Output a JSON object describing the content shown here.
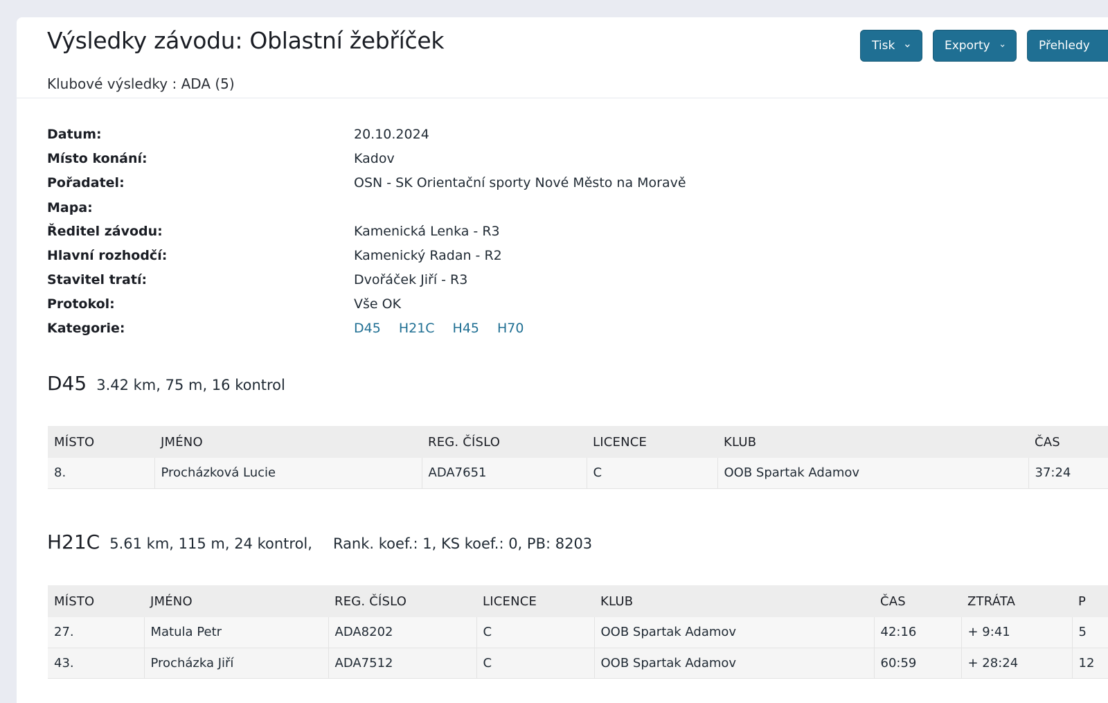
{
  "header": {
    "title": "Výsledky závodu: Oblastní žebříček",
    "subtitle": "Klubové výsledky : ADA (5)",
    "buttons": {
      "tisk": "Tisk",
      "exporty": "Exporty",
      "prehledy": "Přehledy"
    }
  },
  "info": [
    {
      "label": "Datum:",
      "value": "20.10.2024"
    },
    {
      "label": "Místo konání:",
      "value": "Kadov"
    },
    {
      "label": "Pořadatel:",
      "value": "OSN - SK Orientační sporty Nové Město na Moravě"
    },
    {
      "label": "Mapa:",
      "value": ""
    },
    {
      "label": "Ředitel závodu:",
      "value": "Kamenická Lenka - R3"
    },
    {
      "label": "Hlavní rozhodčí:",
      "value": "Kamenický Radan - R2"
    },
    {
      "label": "Stavitel tratí:",
      "value": "Dvořáček Jiří - R3"
    },
    {
      "label": "Protokol:",
      "value": "Vše OK"
    },
    {
      "label": "Kategorie:",
      "value": ""
    }
  ],
  "categories": [
    "D45",
    "H21C",
    "H45",
    "H70"
  ],
  "sections": {
    "d45": {
      "code": "D45",
      "desc": "3.42 km, 75 m, 16 kontrol",
      "columns": [
        "Místo",
        "Jméno",
        "Reg. číslo",
        "Licence",
        "Klub",
        "Čas"
      ],
      "rows": [
        [
          "8.",
          "Procházková Lucie",
          "ADA7651",
          "C",
          "OOB Spartak Adamov",
          "37:24"
        ]
      ]
    },
    "h21c": {
      "code": "H21C",
      "desc": "5.61 km, 115 m, 24 kontrol,",
      "extra": "Rank. koef.: 1, KS koef.: 0, PB: 8203",
      "columns": [
        "Místo",
        "Jméno",
        "Reg. číslo",
        "Licence",
        "Klub",
        "Čas",
        "Ztráta",
        "P"
      ],
      "rows": [
        [
          "27.",
          "Matula Petr",
          "ADA8202",
          "C",
          "OOB Spartak Adamov",
          "42:16",
          "+ 9:41",
          "5"
        ],
        [
          "43.",
          "Procházka Jiří",
          "ADA7512",
          "C",
          "OOB Spartak Adamov",
          "60:59",
          "+ 28:24",
          "12"
        ]
      ]
    }
  }
}
